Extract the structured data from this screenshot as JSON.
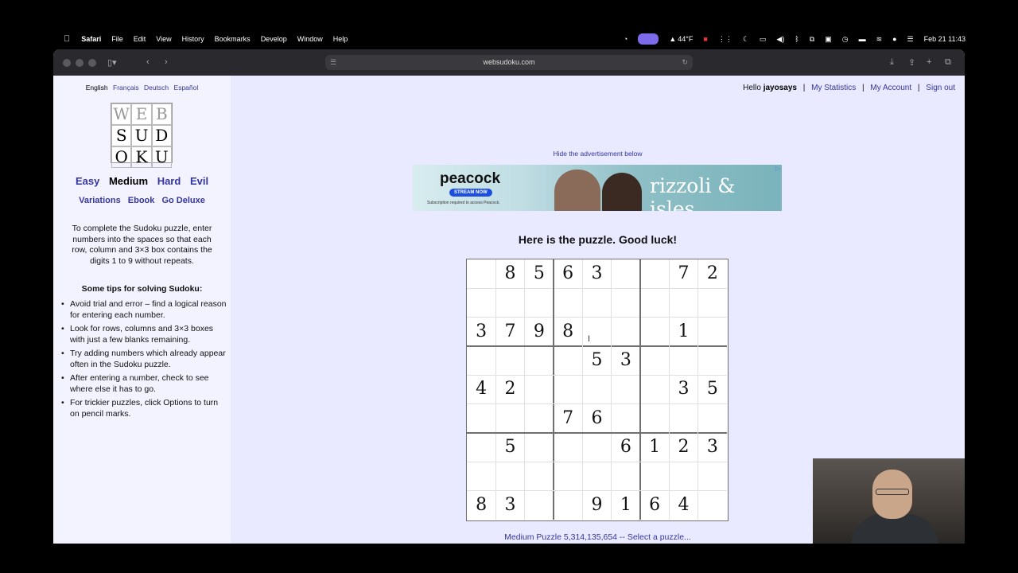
{
  "menubar": {
    "app": "Safari",
    "items": [
      "File",
      "Edit",
      "View",
      "History",
      "Bookmarks",
      "Develop",
      "Window",
      "Help"
    ],
    "weather": "44°F",
    "datetime": "Feb 21  11:43"
  },
  "browser": {
    "url": "websudoku.com"
  },
  "sidebar": {
    "languages": [
      "English",
      "Français",
      "Deutsch",
      "Español"
    ],
    "logo_letters": [
      "W",
      "E",
      "B",
      "S",
      "U",
      "D",
      "O",
      "K",
      "U"
    ],
    "levels": [
      "Easy",
      "Medium",
      "Hard",
      "Evil"
    ],
    "links": [
      "Variations",
      "Ebook",
      "Go Deluxe"
    ],
    "intro": "To complete the Sudoku puzzle, enter numbers into the spaces so that each row, column and 3×3 box contains the digits 1 to 9 without repeats.",
    "tips_heading": "Some tips for solving Sudoku:",
    "tips": [
      "Avoid trial and error – find a logical reason for entering each number.",
      "Look for rows, columns and 3×3 boxes with just a few blanks remaining.",
      "Try adding numbers which already appear often in the Sudoku puzzle.",
      "After entering a number, check to see where else it has to go.",
      "For trickier puzzles, click Options to turn on pencil marks."
    ]
  },
  "header": {
    "hello": "Hello",
    "username": "jayosays",
    "links": [
      "My Statistics",
      "My Account",
      "Sign out"
    ]
  },
  "ad": {
    "hide_label": "Hide the advertisement below",
    "brand": "peacock",
    "cta": "STREAM NOW",
    "fineprint": "Subscription required to access Peacock.",
    "show": "rizzoli & isles"
  },
  "puzzle": {
    "title": "Here is the puzzle. Good luck!",
    "grid": [
      [
        "",
        "8",
        "5",
        "6",
        "3",
        "",
        "",
        "7",
        "2"
      ],
      [
        "",
        "",
        "",
        "",
        "",
        "",
        "",
        "",
        ""
      ],
      [
        "3",
        "7",
        "9",
        "8",
        "",
        "",
        "",
        "1",
        ""
      ],
      [
        "",
        "",
        "",
        "",
        "5",
        "3",
        "",
        "",
        ""
      ],
      [
        "4",
        "2",
        "",
        "",
        "",
        "",
        "",
        "3",
        "5"
      ],
      [
        "",
        "",
        "",
        "7",
        "6",
        "",
        "",
        "",
        ""
      ],
      [
        "",
        "5",
        "",
        "",
        "",
        "6",
        "1",
        "2",
        "3"
      ],
      [
        "",
        "",
        "",
        "",
        "",
        "",
        "",
        "",
        ""
      ],
      [
        "8",
        "3",
        "",
        "",
        "9",
        "1",
        "6",
        "4",
        ""
      ]
    ],
    "footer": "Medium Puzzle 5,314,135,654 -- Select a puzzle..."
  }
}
